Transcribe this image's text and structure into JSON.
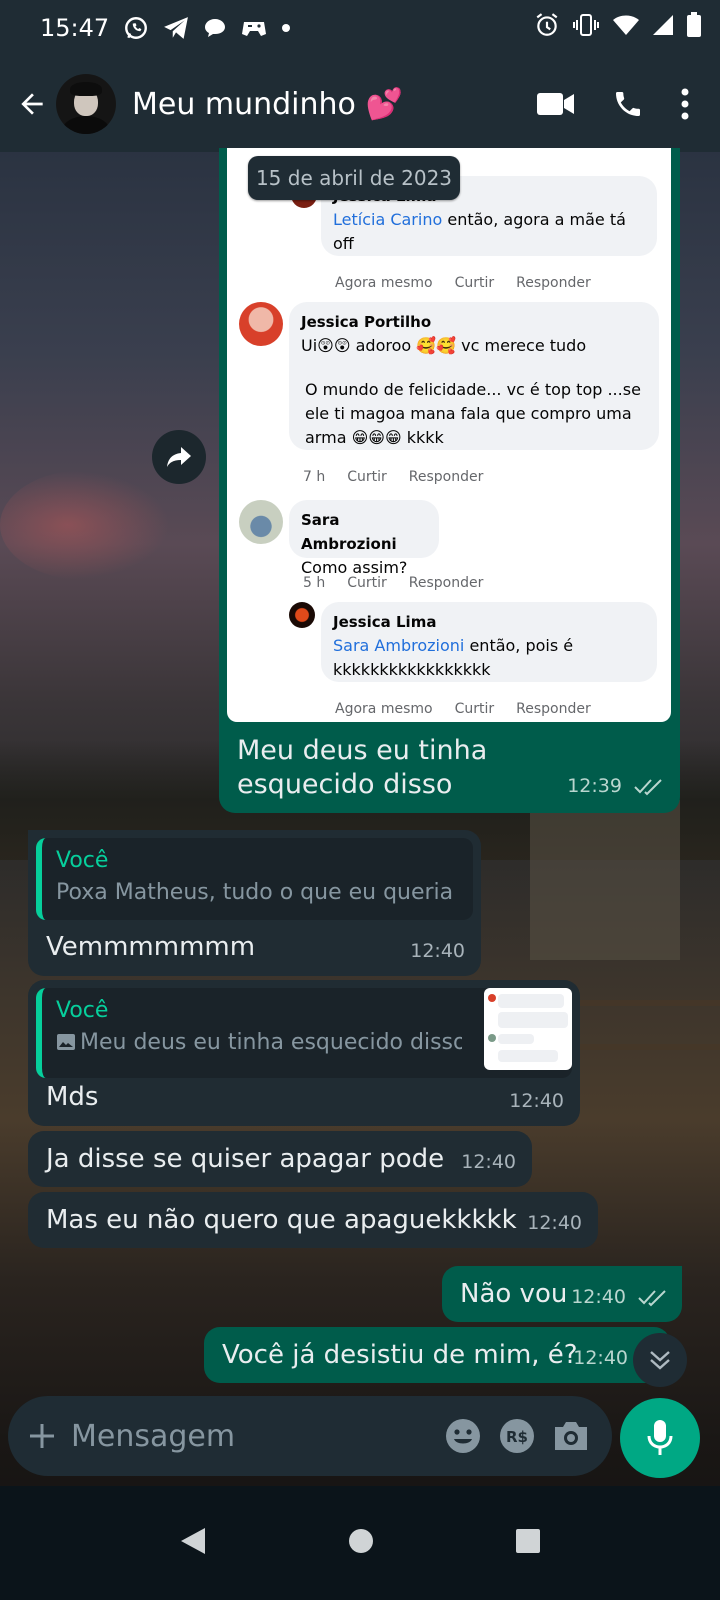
{
  "status_bar": {
    "time": "15:47"
  },
  "chat": {
    "title": "Meu mundinho 💕"
  },
  "date_chip": "15 de abril de 2023",
  "screenshot_comments": [
    {
      "author": "Jessica Lima",
      "tag": "Letícia Carino",
      "text": "então, agora a mãe tá off",
      "time": "Agora mesmo",
      "like": "Curtir",
      "reply": "Responder"
    },
    {
      "author": "Jessica Portilho",
      "text_line1": "Ui😲😲 adoroo 🥰🥰 vc merece tudo",
      "text_line2": "O mundo de felicidade... vc é top top ...se ele ti magoa mana fala que compro uma arma 😁😁😁 kkkk",
      "time": "7 h",
      "like": "Curtir",
      "reply": "Responder"
    },
    {
      "author": "Sara Ambrozioni",
      "text": "Como assim?",
      "time": "5 h",
      "like": "Curtir",
      "reply": "Responder"
    },
    {
      "author": "Jessica Lima",
      "tag": "Sara Ambrozioni",
      "text": "então, pois é kkkkkkkkkkkkkkkkk",
      "time": "Agora mesmo",
      "like": "Curtir",
      "reply": "Responder"
    }
  ],
  "messages": {
    "m1": {
      "text": "Meu deus eu tinha esquecido disso",
      "time": "12:39"
    },
    "m2": {
      "quote_author": "Você",
      "quote_text": "Poxa Matheus, tudo o que eu queria",
      "text": "Vemmmmmmm",
      "time": "12:40"
    },
    "m3": {
      "quote_author": "Você",
      "quote_text": "Meu deus eu tinha esquecido disso",
      "text": "Mds",
      "time": "12:40"
    },
    "m4": {
      "text": "Ja disse se quiser apagar pode",
      "time": "12:40"
    },
    "m5": {
      "text": "Mas eu não quero que apaguekkkkk",
      "time": "12:40"
    },
    "m6": {
      "text": "Não vou",
      "time": "12:40"
    },
    "m7": {
      "text": "Você já desistiu de mim, é?",
      "time": "12:40"
    }
  },
  "composer": {
    "placeholder": "Mensagem"
  },
  "colors": {
    "header": "#1f2c34",
    "incoming": "#202c33",
    "outgoing": "#005c4b",
    "accent": "#00a884",
    "quote_author": "#06cf9c",
    "fb_link": "#216fdb"
  }
}
